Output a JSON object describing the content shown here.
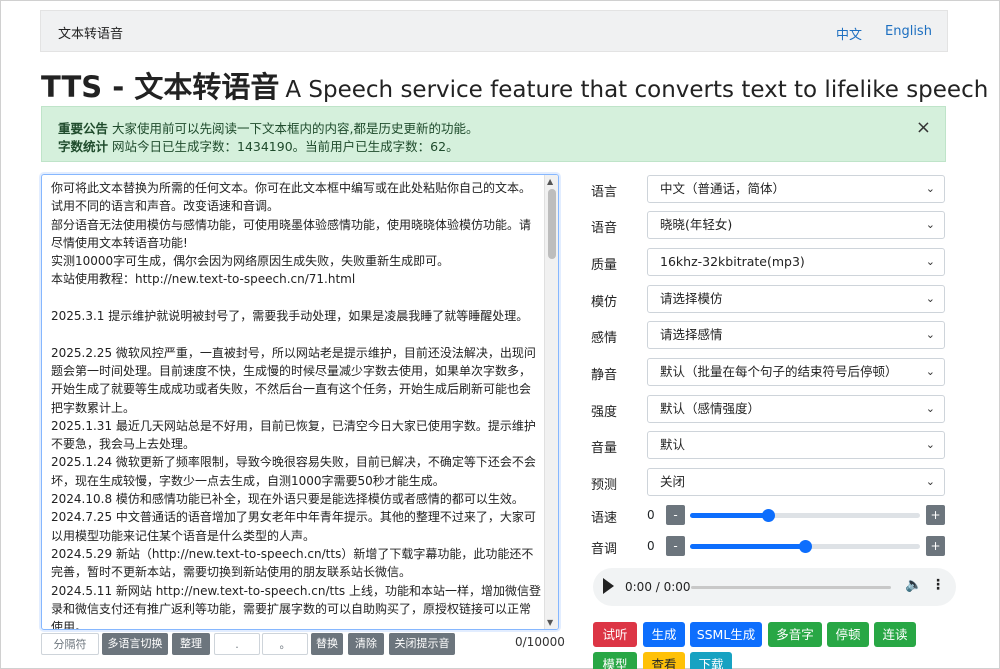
{
  "nav": {
    "brand": "文本转语音",
    "lang_zh": "中文",
    "lang_en": "English"
  },
  "heading": {
    "main": "TTS - 文本转语音",
    "sub": "A Speech service feature that converts text to lifelike speech"
  },
  "alert": {
    "label1": "重要公告",
    "text1": "大家使用前可以先阅读一下文本框内的内容,都是历史更新的功能。",
    "label2": "字数统计",
    "text2": "网站今日已生成字数：1434190。当前用户已生成字数：62。",
    "close": "×"
  },
  "textarea": {
    "content": "你可将此文本替换为所需的任何文本。你可在此文本框中编写或在此处粘贴你自己的文本。\n试用不同的语言和声音。改变语速和音调。\n部分语音无法使用模仿与感情功能，可使用晓墨体验感情功能，使用晓晓体验模仿功能。请尽情使用文本转语音功能!\n实测10000字可生成，偶尔会因为网络原因生成失败，失败重新生成即可。\n本站使用教程：http://new.text-to-speech.cn/71.html\n\n2025.3.1 提示维护就说明被封号了，需要我手动处理，如果是凌晨我睡了就等睡醒处理。\n\n2025.2.25 微软风控严重，一直被封号，所以网站老是提示维护，目前还没法解决，出现问题会第一时间处理。目前速度不快，生成慢的时候尽量减少字数去使用，如果单次字数多，开始生成了就要等生成成功或者失败，不然后台一直有这个任务，开始生成后刷新可能也会把字数累计上。\n2025.1.31 最近几天网站总是不好用，目前已恢复，已清空今日大家已使用字数。提示维护不要急，我会马上去处理。\n2025.1.24 微软更新了频率限制，导致今晚很容易失败，目前已解决，不确定等下还会不会坏，现在生成较慢，字数少一点去生成，自测1000字需要50秒才能生成。\n2024.10.8 模仿和感情功能已补全，现在外语只要是能选择模仿或者感情的都可以生效。\n2024.7.25 中文普通话的语音增加了男女老年中年青年提示。其他的整理不过来了，大家可以用模型功能来记住某个语音是什么类型的人声。\n2024.5.29 新站（http://new.text-to-speech.cn/tts）新增了下载字幕功能，此功能还不完善，暂时不更新本站，需要切换到新站使用的朋友联系站长微信。\n2024.5.11 新网站 http://new.text-to-speech.cn/tts 上线，功能和本站一样，增加微信登录和微信支付还有推广返利等功能，需要扩展字数的可以自助购买了，原授权链接可以正常使用。"
  },
  "toolbar": {
    "separator": "分隔符",
    "multilang": "多语言切换",
    "tidy": "整理",
    "find_ph": ".",
    "replace_ph": "。",
    "replace": "替换",
    "clear": "清除",
    "close_tip": "关闭提示音",
    "count": "0/10000"
  },
  "form": {
    "language": {
      "label": "语言",
      "value": "中文（普通话，简体）"
    },
    "voice": {
      "label": "语音",
      "value": "晓晓(年轻女)"
    },
    "quality": {
      "label": "质量",
      "value": "16khz-32kbitrate(mp3)"
    },
    "imitate": {
      "label": "模仿",
      "value": "请选择模仿"
    },
    "emotion": {
      "label": "感情",
      "value": "请选择感情"
    },
    "silence": {
      "label": "静音",
      "value": "默认（批量在每个句子的结束符号后停顿）"
    },
    "intensity": {
      "label": "强度",
      "value": "默认（感情强度）"
    },
    "volume": {
      "label": "音量",
      "value": "默认"
    },
    "predict": {
      "label": "预测",
      "value": "关闭"
    },
    "rate": {
      "label": "语速",
      "value": "0",
      "minus": "-",
      "plus": "+",
      "level": 0.34
    },
    "pitch": {
      "label": "音调",
      "value": "0",
      "minus": "-",
      "plus": "+",
      "level": 0.5
    }
  },
  "audio": {
    "time": "0:00 / 0:00"
  },
  "buttons": {
    "try": "试听",
    "generate": "生成",
    "ssml": "SSML生成",
    "polyphone": "多音字",
    "pause": "停顿",
    "liaison": "连读",
    "model": "模型",
    "view": "查看",
    "download": "下载"
  },
  "colors": {
    "red": "#dc3545",
    "blue": "#0d6efd",
    "green": "#28a745",
    "alert_bg": "#d5f0dc"
  }
}
